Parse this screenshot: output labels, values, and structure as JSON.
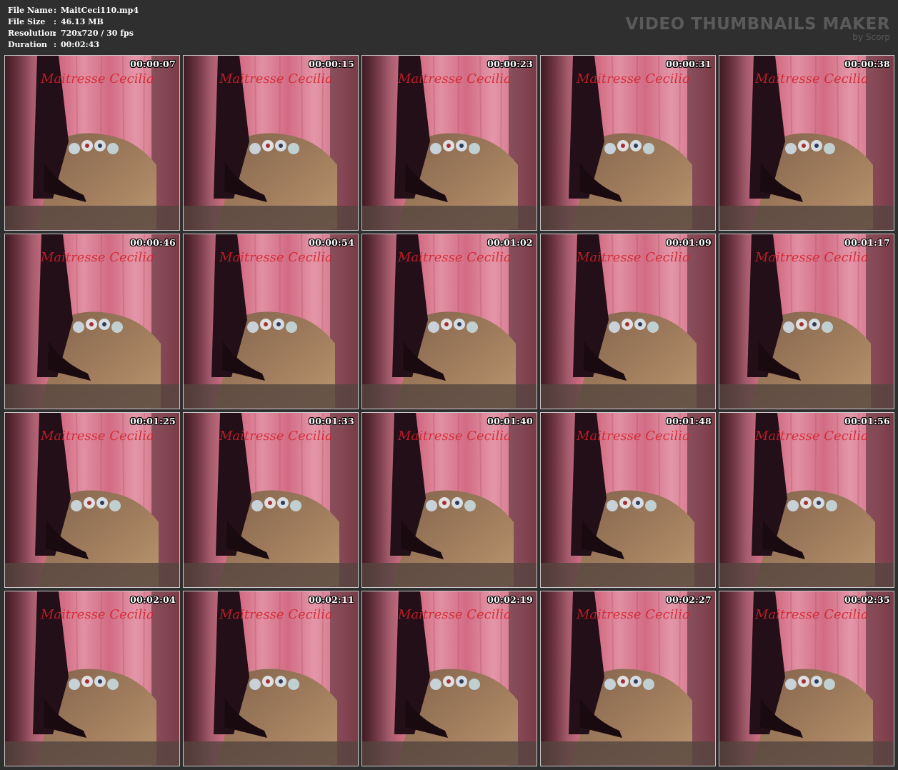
{
  "file_info": {
    "rows": [
      {
        "label": "File Name",
        "sep": ":",
        "value": "MaitCeci110.mp4"
      },
      {
        "label": "File Size",
        "sep": ":",
        "value": "46.13 MB"
      },
      {
        "label": "Resolution",
        "sep": ":",
        "value": "720x720 / 30 fps"
      },
      {
        "label": "Duration",
        "sep": ":",
        "value": "00:02:43"
      }
    ]
  },
  "brand": {
    "title": "VIDEO THUMBNAILS MAKER",
    "subtitle": "by Scorp"
  },
  "watermark_text": "Maitresse Cecilia",
  "colors": {
    "background": "#2f2f2f",
    "brand_text": "#5a5a5a",
    "watermark": "#d4202a",
    "curtain_pink": "#e8758f",
    "thumb_border": "#c8c8c8"
  },
  "thumbnails": [
    {
      "time": "00:00:07"
    },
    {
      "time": "00:00:15"
    },
    {
      "time": "00:00:23"
    },
    {
      "time": "00:00:31"
    },
    {
      "time": "00:00:38"
    },
    {
      "time": "00:00:46"
    },
    {
      "time": "00:00:54"
    },
    {
      "time": "00:01:02"
    },
    {
      "time": "00:01:09"
    },
    {
      "time": "00:01:17"
    },
    {
      "time": "00:01:25"
    },
    {
      "time": "00:01:33"
    },
    {
      "time": "00:01:40"
    },
    {
      "time": "00:01:48"
    },
    {
      "time": "00:01:56"
    },
    {
      "time": "00:02:04"
    },
    {
      "time": "00:02:11"
    },
    {
      "time": "00:02:19"
    },
    {
      "time": "00:02:27"
    },
    {
      "time": "00:02:35"
    }
  ]
}
